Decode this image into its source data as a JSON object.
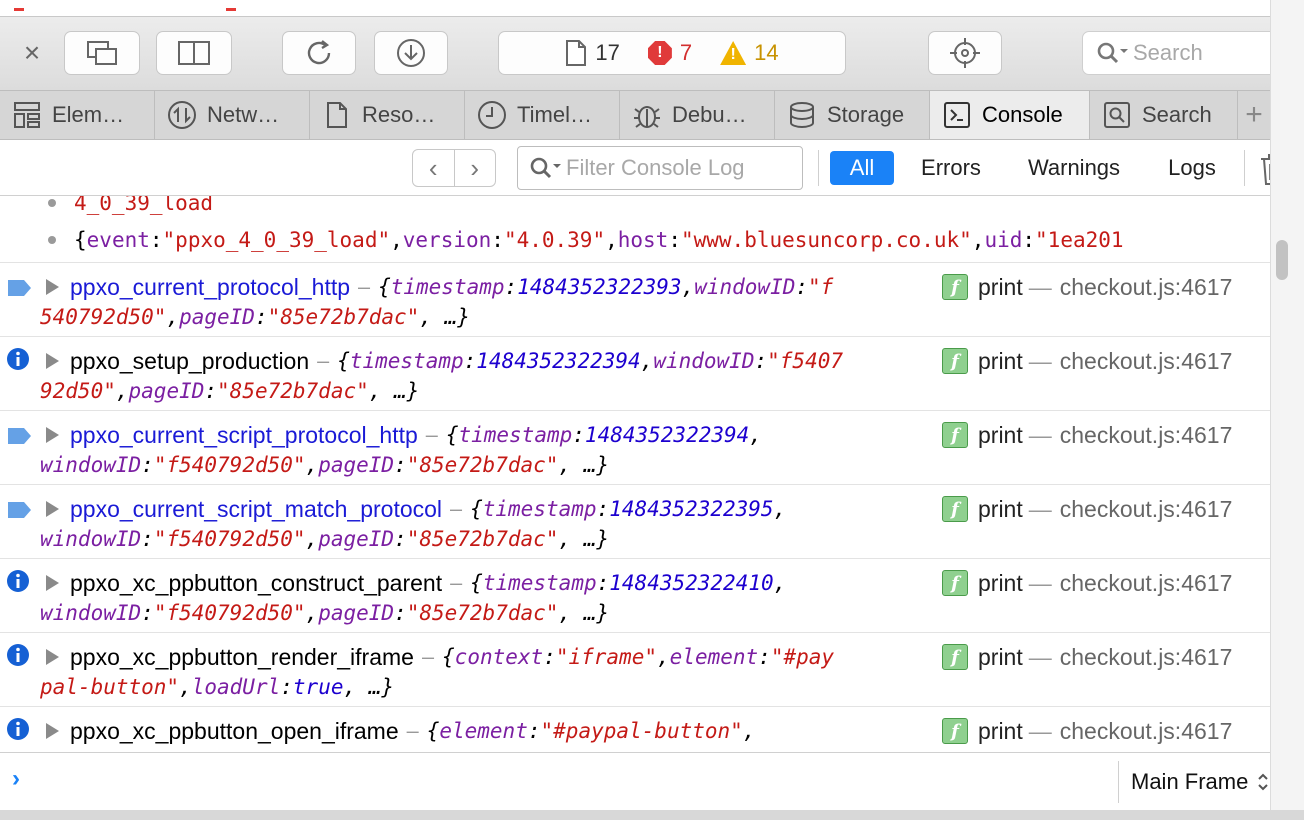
{
  "toolbar": {
    "close_glyph": "×",
    "counts": {
      "logs": "17",
      "errors": "7",
      "warnings": "14"
    },
    "search_placeholder": "Search"
  },
  "tabs": [
    {
      "label": "Elem…",
      "icon": "elements-icon"
    },
    {
      "label": "Netw…",
      "icon": "network-icon"
    },
    {
      "label": "Reso…",
      "icon": "resources-icon"
    },
    {
      "label": "Timel…",
      "icon": "timelines-icon"
    },
    {
      "label": "Debu…",
      "icon": "debugger-icon"
    },
    {
      "label": "Storage",
      "icon": "storage-icon"
    },
    {
      "label": "Console",
      "icon": "console-icon",
      "active": true
    },
    {
      "label": "Search",
      "icon": "search-tab-icon"
    }
  ],
  "filterbar": {
    "filter_placeholder": "Filter Console Log",
    "buttons": {
      "all": "All",
      "errors": "Errors",
      "warnings": "Warnings",
      "logs": "Logs"
    }
  },
  "console": {
    "partial_item": "4_0_39_load",
    "object_item": {
      "open": "{",
      "k1": "event",
      "v1": "\"ppxo_4_0_39_load\"",
      "k2": "version",
      "v2": "\"4.0.39\"",
      "k3": "host",
      "v3": "\"www.bluesuncorp.co.uk\"",
      "k4": "uid",
      "v4": "\"1ea201"
    },
    "messages": [
      {
        "level": "debug",
        "name": "ppxo_current_protocol_http",
        "color": "blue",
        "l1": [
          [
            "p",
            "{"
          ],
          [
            "k",
            "timestamp"
          ],
          [
            "p",
            ": "
          ],
          [
            "n",
            "1484352322393"
          ],
          [
            "p",
            ", "
          ],
          [
            "k",
            "windowID"
          ],
          [
            "p",
            ": "
          ],
          [
            "s",
            "\"f"
          ]
        ],
        "l2": [
          [
            "s",
            "540792d50\""
          ],
          [
            "p",
            ", "
          ],
          [
            "k",
            "pageID"
          ],
          [
            "p",
            ": "
          ],
          [
            "s",
            "\"85e72b7dac\""
          ],
          [
            "p",
            ", …}"
          ]
        ]
      },
      {
        "level": "info",
        "name": "ppxo_setup_production",
        "color": "black",
        "l1": [
          [
            "p",
            "{"
          ],
          [
            "k",
            "timestamp"
          ],
          [
            "p",
            ": "
          ],
          [
            "n",
            "1484352322394"
          ],
          [
            "p",
            ", "
          ],
          [
            "k",
            "windowID"
          ],
          [
            "p",
            ": "
          ],
          [
            "s",
            "\"f5407"
          ]
        ],
        "l2": [
          [
            "s",
            "92d50\""
          ],
          [
            "p",
            ", "
          ],
          [
            "k",
            "pageID"
          ],
          [
            "p",
            ": "
          ],
          [
            "s",
            "\"85e72b7dac\""
          ],
          [
            "p",
            ", …}"
          ]
        ]
      },
      {
        "level": "debug",
        "name": "ppxo_current_script_protocol_http",
        "color": "blue",
        "l1": [
          [
            "p",
            "{"
          ],
          [
            "k",
            "timestamp"
          ],
          [
            "p",
            ": "
          ],
          [
            "n",
            "1484352322394"
          ],
          [
            "p",
            ","
          ]
        ],
        "l2": [
          [
            "k",
            "windowID"
          ],
          [
            "p",
            ": "
          ],
          [
            "s",
            "\"f540792d50\""
          ],
          [
            "p",
            ", "
          ],
          [
            "k",
            "pageID"
          ],
          [
            "p",
            ": "
          ],
          [
            "s",
            "\"85e72b7dac\""
          ],
          [
            "p",
            ", …}"
          ]
        ]
      },
      {
        "level": "debug",
        "name": "ppxo_current_script_match_protocol",
        "color": "blue",
        "l1": [
          [
            "p",
            "{"
          ],
          [
            "k",
            "timestamp"
          ],
          [
            "p",
            ": "
          ],
          [
            "n",
            "1484352322395"
          ],
          [
            "p",
            ","
          ]
        ],
        "l2": [
          [
            "k",
            "windowID"
          ],
          [
            "p",
            ": "
          ],
          [
            "s",
            "\"f540792d50\""
          ],
          [
            "p",
            ", "
          ],
          [
            "k",
            "pageID"
          ],
          [
            "p",
            ": "
          ],
          [
            "s",
            "\"85e72b7dac\""
          ],
          [
            "p",
            ", …}"
          ]
        ]
      },
      {
        "level": "info",
        "name": "ppxo_xc_ppbutton_construct_parent",
        "color": "black",
        "l1": [
          [
            "p",
            "{"
          ],
          [
            "k",
            "timestamp"
          ],
          [
            "p",
            ": "
          ],
          [
            "n",
            "1484352322410"
          ],
          [
            "p",
            ","
          ]
        ],
        "l2": [
          [
            "k",
            "windowID"
          ],
          [
            "p",
            ": "
          ],
          [
            "s",
            "\"f540792d50\""
          ],
          [
            "p",
            ", "
          ],
          [
            "k",
            "pageID"
          ],
          [
            "p",
            ": "
          ],
          [
            "s",
            "\"85e72b7dac\""
          ],
          [
            "p",
            ", …}"
          ]
        ]
      },
      {
        "level": "info",
        "name": "ppxo_xc_ppbutton_render_iframe",
        "color": "black",
        "l1": [
          [
            "p",
            "{"
          ],
          [
            "k",
            "context"
          ],
          [
            "p",
            ": "
          ],
          [
            "s",
            "\"iframe\""
          ],
          [
            "p",
            ", "
          ],
          [
            "k",
            "element"
          ],
          [
            "p",
            ": "
          ],
          [
            "s",
            "\"#pay"
          ]
        ],
        "l2": [
          [
            "s",
            "pal-button\""
          ],
          [
            "p",
            ", "
          ],
          [
            "k",
            "loadUrl"
          ],
          [
            "p",
            ": "
          ],
          [
            "n",
            "true"
          ],
          [
            "p",
            ", …}"
          ]
        ]
      },
      {
        "level": "info",
        "name": "ppxo_xc_ppbutton_open_iframe",
        "color": "black",
        "l1": [
          [
            "p",
            "{"
          ],
          [
            "k",
            "element"
          ],
          [
            "p",
            ": "
          ],
          [
            "s",
            "\"#paypal-button\""
          ],
          [
            "p",
            ","
          ]
        ],
        "l2": []
      }
    ],
    "source_function": "print",
    "source_separator": "—",
    "source_location": "checkout.js:4617",
    "f_badge": "f",
    "message_separator": "–"
  },
  "prompt": {
    "caret": "›",
    "frame_select": "Main Frame",
    "frame_arrows": "⌃⌄"
  },
  "colors": {
    "accent": "#1a82f7",
    "error": "#e03a3a",
    "warning": "#f0b400",
    "debug_badge": "#4a90e2",
    "info_icon": "#1560d4"
  }
}
